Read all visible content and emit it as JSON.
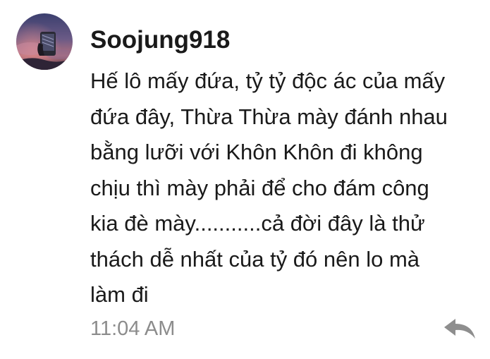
{
  "comment": {
    "username": "Soojung918",
    "lines": [
      "Hế lô mấy đứa, tỷ tỷ độc ác của mấy",
      "đứa đây, Thừa Thừa mày đánh nhau",
      "bằng lưỡi với Khôn Khôn đi không",
      "chịu thì mày phải để cho đám công",
      "kia đè mày...........cả đời đây là thử",
      "thách dễ nhất của tỷ đó nên lo mà",
      "làm đi"
    ],
    "timestamp": "11:04 AM",
    "reply_icon": "reply-arrow-icon",
    "avatar_icon": "user-avatar"
  },
  "colors": {
    "text": "#1a1a1a",
    "timestamp": "#8c8c8c",
    "reply_icon": "#8e8e8e"
  }
}
